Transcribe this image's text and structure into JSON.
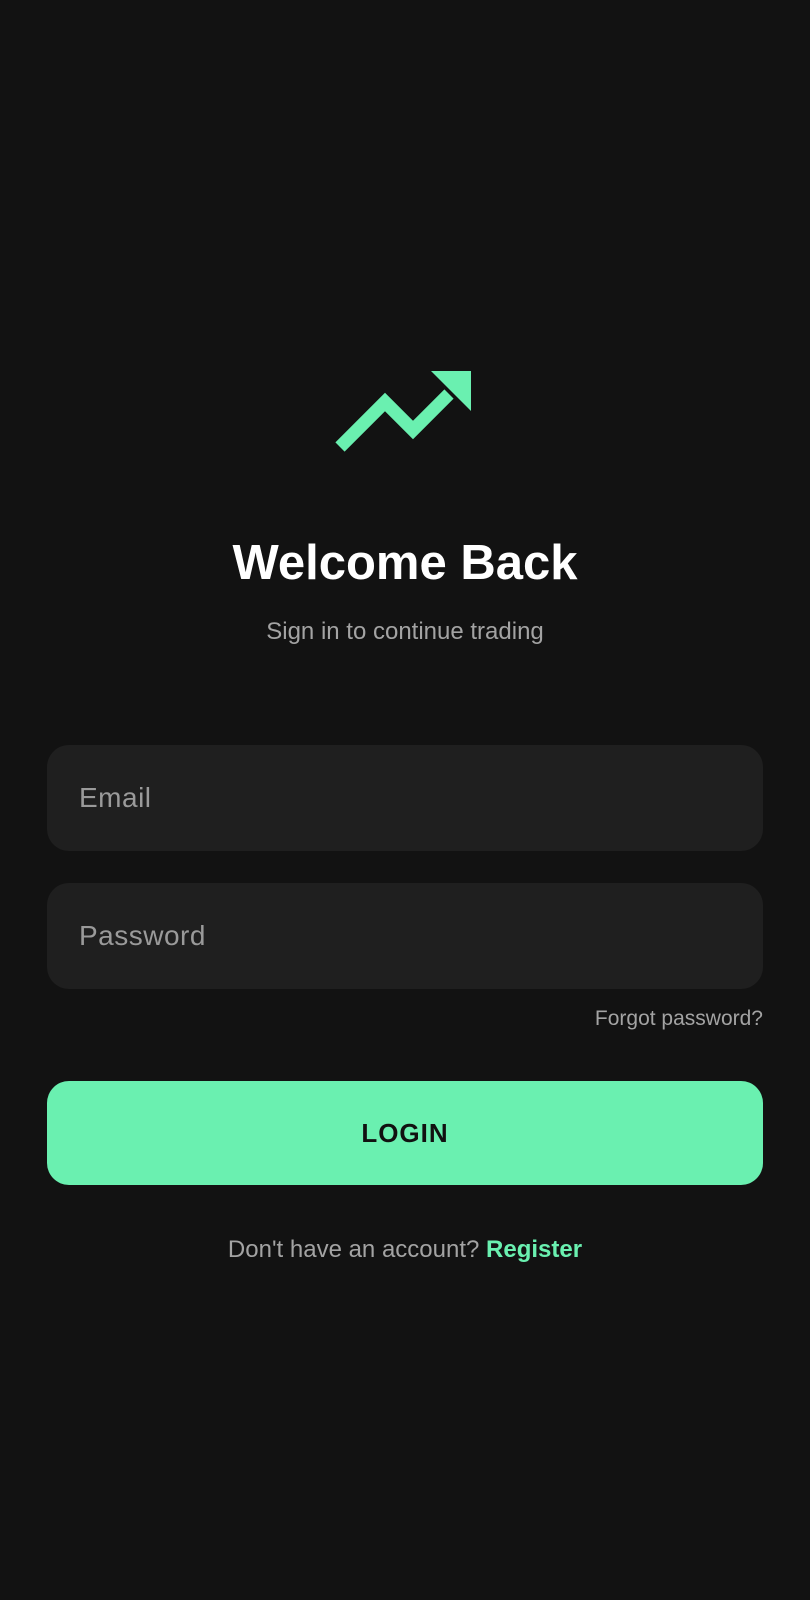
{
  "colors": {
    "background": "#121212",
    "accent": "#6af0b0",
    "field_background": "#1f1f1f",
    "muted_text": "#a3a3a3"
  },
  "logo": {
    "icon": "trending-up-icon"
  },
  "header": {
    "title": "Welcome Back",
    "subtitle": "Sign in to continue trading"
  },
  "form": {
    "email_placeholder": "Email",
    "email_value": "",
    "password_placeholder": "Password",
    "password_value": "",
    "forgot_label": "Forgot password?",
    "login_label": "LOGIN"
  },
  "footer": {
    "prompt": "Don't have an account? ",
    "register_label": "Register"
  }
}
